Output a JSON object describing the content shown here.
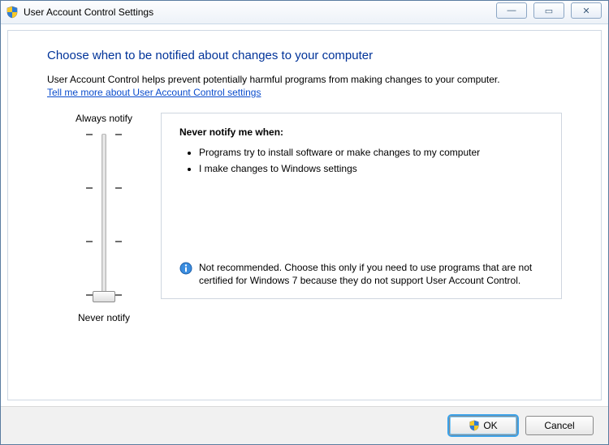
{
  "window": {
    "title": "User Account Control Settings",
    "controls": {
      "minimize": "—",
      "maximize": "▭",
      "close": "✕"
    }
  },
  "heading": "Choose when to be notified about changes to your computer",
  "intro": "User Account Control helps prevent potentially harmful programs from making changes to your computer.",
  "help_link": "Tell me more about User Account Control settings",
  "slider": {
    "top_label": "Always notify",
    "bottom_label": "Never notify",
    "levels": 4,
    "current_level": 0
  },
  "description": {
    "title": "Never notify me when:",
    "bullets": [
      "Programs try to install software or make changes to my computer",
      "I make changes to Windows settings"
    ],
    "warning": "Not recommended. Choose this only if you need to use programs that are not certified for Windows 7 because they do not support User Account Control."
  },
  "buttons": {
    "ok": "OK",
    "cancel": "Cancel"
  }
}
